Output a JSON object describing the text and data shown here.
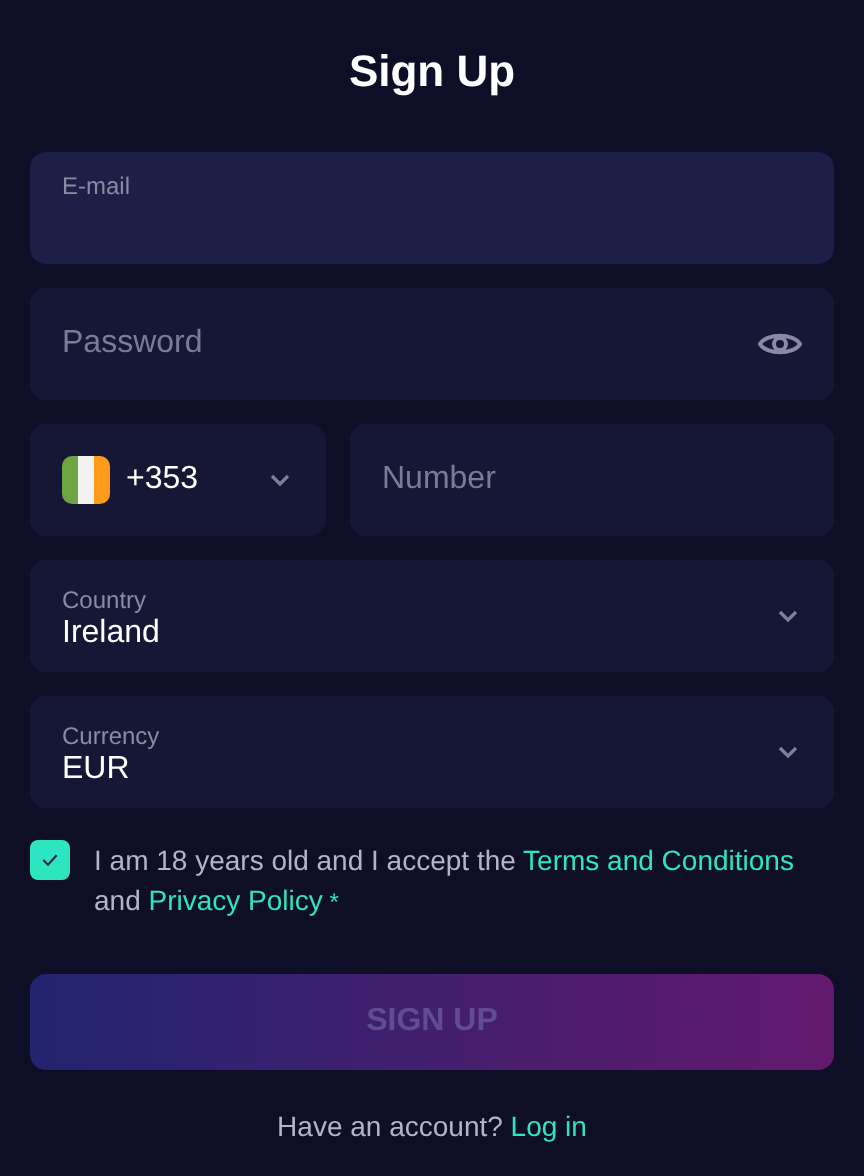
{
  "title": "Sign Up",
  "email": {
    "label": "E-mail",
    "focused": true
  },
  "password": {
    "placeholder": "Password"
  },
  "phone": {
    "code": "+353",
    "number_placeholder": "Number"
  },
  "country": {
    "label": "Country",
    "value": "Ireland"
  },
  "currency": {
    "label": "Currency",
    "value": "EUR"
  },
  "agreement": {
    "checked": true,
    "text_before": "I am 18 years old and I accept the",
    "terms_link": "Terms and Conditions",
    "text_middle": "and",
    "privacy_link": "Privacy Policy",
    "required_mark": "*"
  },
  "submit": {
    "label": "SIGN UP",
    "disabled": true
  },
  "footer": {
    "text": "Have an account?",
    "link": "Log in"
  }
}
